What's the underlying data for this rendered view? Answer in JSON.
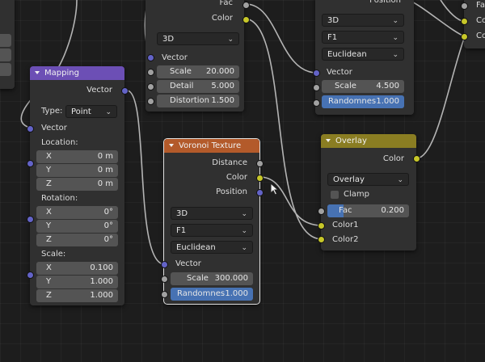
{
  "mapping": {
    "title": "Mapping",
    "out_vector": "Vector",
    "type_label": "Type:",
    "type_value": "Point",
    "in_vector": "Vector",
    "location": {
      "label": "Location:",
      "x": {
        "k": "X",
        "v": "0 m"
      },
      "y": {
        "k": "Y",
        "v": "0 m"
      },
      "z": {
        "k": "Z",
        "v": "0 m"
      }
    },
    "rotation": {
      "label": "Rotation:",
      "x": {
        "k": "X",
        "v": "0°"
      },
      "y": {
        "k": "Y",
        "v": "0°"
      },
      "z": {
        "k": "Z",
        "v": "0°"
      }
    },
    "scale": {
      "label": "Scale:",
      "x": {
        "k": "X",
        "v": "0.100"
      },
      "y": {
        "k": "Y",
        "v": "1.000"
      },
      "z": {
        "k": "Z",
        "v": "1.000"
      }
    }
  },
  "noise_top": {
    "fac": "Fac",
    "color": "Color",
    "dimensions": "3D",
    "vector": "Vector",
    "scale": {
      "label": "Scale",
      "value": "20.000"
    },
    "detail": {
      "label": "Detail",
      "value": "5.000"
    },
    "distortion": {
      "label": "Distortion",
      "value": "1.500"
    }
  },
  "voronoi_top": {
    "position": "Position",
    "dimensions": "3D",
    "feature": "F1",
    "metric": "Euclidean",
    "vector": "Vector",
    "scale": {
      "label": "Scale",
      "value": "4.500"
    },
    "randomness": {
      "label": "Randomnes",
      "value": "1.000"
    }
  },
  "far_right": {
    "fac": "Fa",
    "c1": "Co",
    "c2": "Co"
  },
  "voronoi": {
    "title": "Voronoi Texture",
    "distance": "Distance",
    "color": "Color",
    "position": "Position",
    "dimensions": "3D",
    "feature": "F1",
    "metric": "Euclidean",
    "vector": "Vector",
    "scale": {
      "label": "Scale",
      "value": "300.000"
    },
    "randomness": {
      "label": "Randomnes",
      "value": "1.000"
    }
  },
  "overlay": {
    "title": "Overlay",
    "color_out": "Color",
    "blend_mode": "Overlay",
    "clamp": "Clamp",
    "fac": {
      "label": "Fac",
      "value": "0.200"
    },
    "color1": "Color1",
    "color2": "Color2"
  },
  "colors": {
    "vector_socket": "#6363c7",
    "color_socket": "#c7c729",
    "float_socket": "#a1a1a1",
    "mapping_header": "#6c4fb5",
    "texture_header": "#b35a2a",
    "color_header": "#8a7d22",
    "active_field": "#4772b3"
  }
}
